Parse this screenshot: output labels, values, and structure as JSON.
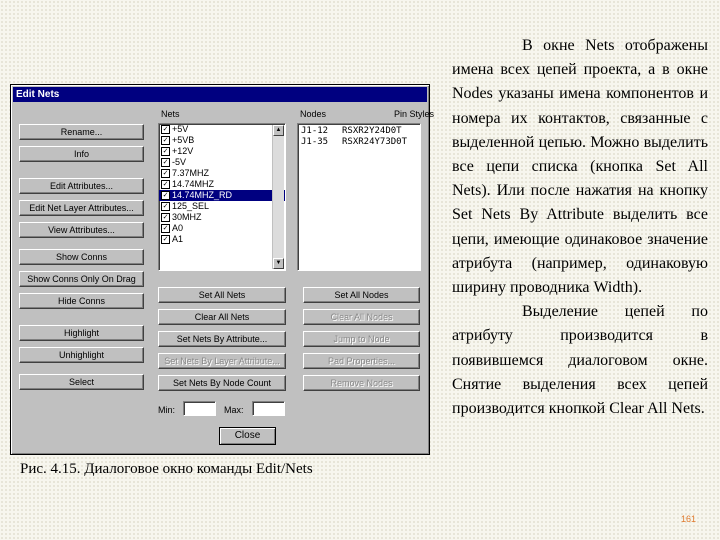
{
  "dialog": {
    "title": "Edit Nets",
    "labels": {
      "nets": "Nets",
      "nodes": "Nodes",
      "pin_styles": "Pin Styles",
      "min": "Min:",
      "max": "Max:"
    },
    "left_buttons": [
      "Rename...",
      "Info",
      "Edit Attributes...",
      "Edit Net Layer Attributes...",
      "View Attributes...",
      "Show Conns",
      "Show Conns Only On Drag",
      "Hide Conns",
      "Highlight",
      "Unhighlight",
      "Select"
    ],
    "nets": [
      {
        "name": "+5V",
        "checked": true,
        "selected": false
      },
      {
        "name": "+5VB",
        "checked": true,
        "selected": false
      },
      {
        "name": "+12V",
        "checked": true,
        "selected": false
      },
      {
        "name": "-5V",
        "checked": true,
        "selected": false
      },
      {
        "name": "7.37MHZ",
        "checked": true,
        "selected": false
      },
      {
        "name": "14.74MHZ",
        "checked": true,
        "selected": false
      },
      {
        "name": "14.74MHZ_RD",
        "checked": true,
        "selected": true
      },
      {
        "name": "125_SEL",
        "checked": true,
        "selected": false
      },
      {
        "name": "30MHZ",
        "checked": true,
        "selected": false
      },
      {
        "name": "A0",
        "checked": true,
        "selected": false
      },
      {
        "name": "A1",
        "checked": true,
        "selected": false
      }
    ],
    "nodes": [
      {
        "node": "J1-12",
        "style": "RSXR2Y24D0T"
      },
      {
        "node": "J1-35",
        "style": "RSXR24Y73D0T"
      }
    ],
    "mid_buttons": [
      {
        "label": "Set All Nets",
        "disabled": false
      },
      {
        "label": "Clear All Nets",
        "disabled": false
      },
      {
        "label": "Set Nets By Attribute...",
        "disabled": false
      },
      {
        "label": "Set Nets By Layer Attribute...",
        "disabled": true
      },
      {
        "label": "Set Nets By Node Count",
        "disabled": false
      }
    ],
    "right_buttons": [
      {
        "label": "Set All Nodes",
        "disabled": false
      },
      {
        "label": "Clear All Nodes",
        "disabled": true
      },
      {
        "label": "Jump to Node",
        "disabled": true
      },
      {
        "label": "Pad Properties...",
        "disabled": true
      },
      {
        "label": "Remove Nodes",
        "disabled": true
      }
    ],
    "min_value": "",
    "max_value": "",
    "close_label": "Close"
  },
  "caption": "Рис. 4.15. Диалоговое окно команды Edit/Nets",
  "text": {
    "p1": "В окне Nets отображены имена всех цепей проекта, а в окне Nodes указаны имена компонентов и номера их контактов, связанные с выделенной цепью. Можно выделить все цепи списка (кнопка Set All Nets). Или после нажатия на кнопку Set Nets By Attribute выделить все цепи, имеющие одинаковое значение атрибута (например, одинаковую ширину проводника Width).",
    "p2": "Выделение цепей по атрибуту производится в появившемся диалоговом окне. Снятие выделения всех цепей производится кнопкой Clear All Nets."
  },
  "page_number": "161",
  "colors": {
    "titlebar": "#000080",
    "selection": "#000080",
    "dialog_bg": "#c0c0c0",
    "page_number": "#e07a2e"
  }
}
